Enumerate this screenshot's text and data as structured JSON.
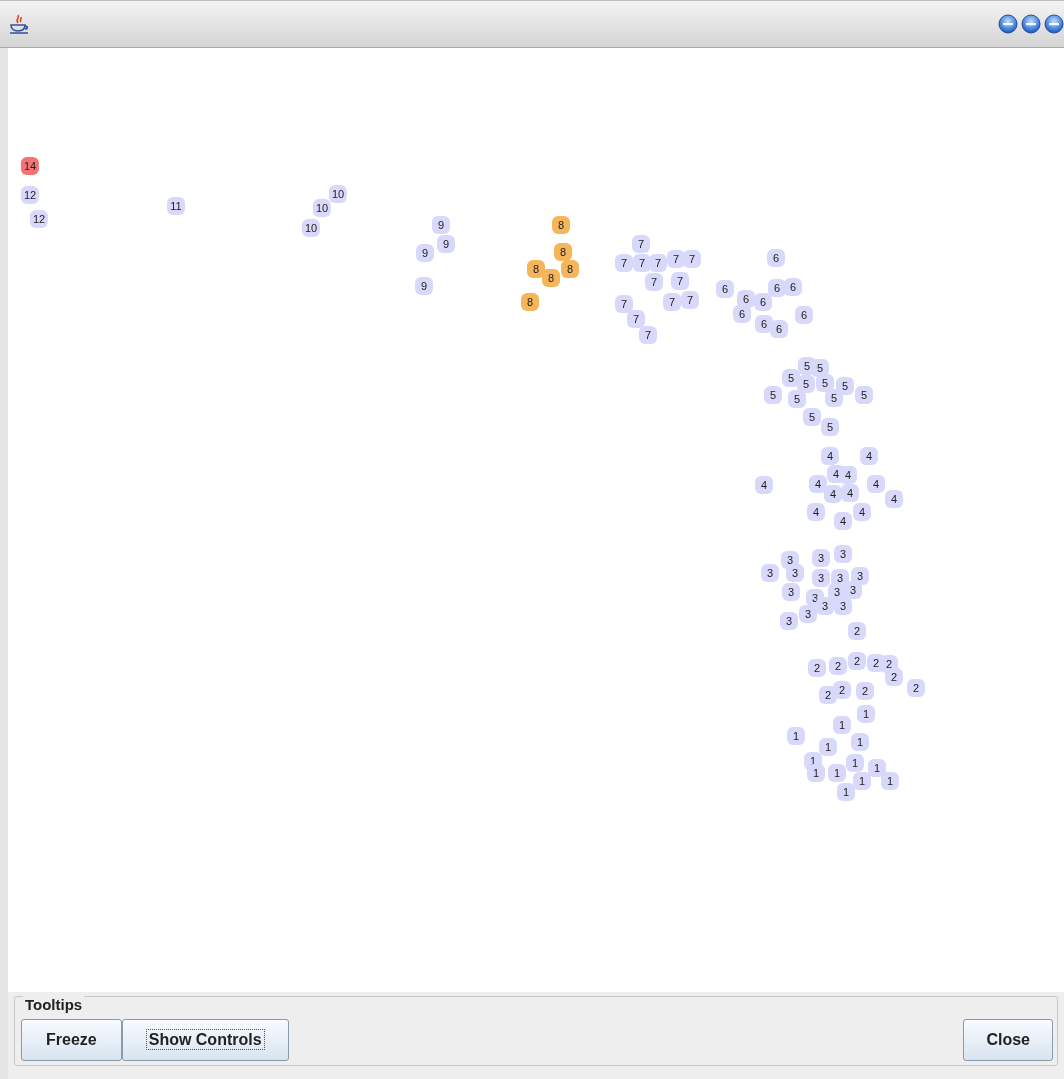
{
  "graph": {
    "nodes": [
      {
        "label": "14",
        "color": "#f47474"
      },
      {
        "label": "12",
        "color": "#d8d8fb"
      },
      {
        "label": "12",
        "color": "#d8d8fb"
      },
      {
        "label": "11",
        "color": "#d8d8fb"
      },
      {
        "label": "10",
        "color": "#d8d8fb"
      },
      {
        "label": "10",
        "color": "#d8d8fb"
      },
      {
        "label": "10",
        "color": "#d8d8fb"
      },
      {
        "label": "9",
        "color": "#d8d8fb"
      },
      {
        "label": "9",
        "color": "#d8d8fb"
      },
      {
        "label": "9",
        "color": "#d8d8fb"
      },
      {
        "label": "9",
        "color": "#d8d8fb"
      },
      {
        "label": "8",
        "color": "#f5b65a"
      },
      {
        "label": "8",
        "color": "#f5b65a"
      },
      {
        "label": "8",
        "color": "#f5b65a"
      },
      {
        "label": "8",
        "color": "#f5b65a"
      },
      {
        "label": "8",
        "color": "#f5b65a"
      },
      {
        "label": "8",
        "color": "#f5b65a"
      },
      {
        "label": "7",
        "color": "#d8d8fb"
      },
      {
        "label": "7",
        "color": "#d8d8fb"
      },
      {
        "label": "7",
        "color": "#d8d8fb"
      },
      {
        "label": "7",
        "color": "#d8d8fb"
      },
      {
        "label": "7",
        "color": "#d8d8fb"
      },
      {
        "label": "7",
        "color": "#d8d8fb"
      },
      {
        "label": "7",
        "color": "#d8d8fb"
      },
      {
        "label": "7",
        "color": "#d8d8fb"
      },
      {
        "label": "7",
        "color": "#d8d8fb"
      },
      {
        "label": "7",
        "color": "#d8d8fb"
      },
      {
        "label": "7",
        "color": "#d8d8fb"
      },
      {
        "label": "7",
        "color": "#d8d8fb"
      },
      {
        "label": "7",
        "color": "#d8d8fb"
      },
      {
        "label": "6",
        "color": "#d8d8fb"
      },
      {
        "label": "6",
        "color": "#d8d8fb"
      },
      {
        "label": "6",
        "color": "#d8d8fb"
      },
      {
        "label": "6",
        "color": "#d8d8fb"
      },
      {
        "label": "6",
        "color": "#d8d8fb"
      },
      {
        "label": "6",
        "color": "#d8d8fb"
      },
      {
        "label": "6",
        "color": "#d8d8fb"
      },
      {
        "label": "6",
        "color": "#d8d8fb"
      },
      {
        "label": "6",
        "color": "#d8d8fb"
      },
      {
        "label": "6",
        "color": "#d8d8fb"
      },
      {
        "label": "5",
        "color": "#d8d8fb"
      },
      {
        "label": "5",
        "color": "#d8d8fb"
      },
      {
        "label": "5",
        "color": "#d8d8fb"
      },
      {
        "label": "5",
        "color": "#d8d8fb"
      },
      {
        "label": "5",
        "color": "#d8d8fb"
      },
      {
        "label": "5",
        "color": "#d8d8fb"
      },
      {
        "label": "5",
        "color": "#d8d8fb"
      },
      {
        "label": "5",
        "color": "#d8d8fb"
      },
      {
        "label": "5",
        "color": "#d8d8fb"
      },
      {
        "label": "5",
        "color": "#d8d8fb"
      },
      {
        "label": "5",
        "color": "#d8d8fb"
      },
      {
        "label": "5",
        "color": "#d8d8fb"
      },
      {
        "label": "4",
        "color": "#d8d8fb"
      },
      {
        "label": "4",
        "color": "#d8d8fb"
      },
      {
        "label": "4",
        "color": "#d8d8fb"
      },
      {
        "label": "4",
        "color": "#d8d8fb"
      },
      {
        "label": "4",
        "color": "#d8d8fb"
      },
      {
        "label": "4",
        "color": "#d8d8fb"
      },
      {
        "label": "4",
        "color": "#d8d8fb"
      },
      {
        "label": "4",
        "color": "#d8d8fb"
      },
      {
        "label": "4",
        "color": "#d8d8fb"
      },
      {
        "label": "4",
        "color": "#d8d8fb"
      },
      {
        "label": "4",
        "color": "#d8d8fb"
      },
      {
        "label": "4",
        "color": "#d8d8fb"
      },
      {
        "label": "4",
        "color": "#d8d8fb"
      },
      {
        "label": "3",
        "color": "#d8d8fb"
      },
      {
        "label": "3",
        "color": "#d8d8fb"
      },
      {
        "label": "3",
        "color": "#d8d8fb"
      },
      {
        "label": "3",
        "color": "#d8d8fb"
      },
      {
        "label": "3",
        "color": "#d8d8fb"
      },
      {
        "label": "3",
        "color": "#d8d8fb"
      },
      {
        "label": "3",
        "color": "#d8d8fb"
      },
      {
        "label": "3",
        "color": "#d8d8fb"
      },
      {
        "label": "3",
        "color": "#d8d8fb"
      },
      {
        "label": "3",
        "color": "#d8d8fb"
      },
      {
        "label": "3",
        "color": "#d8d8fb"
      },
      {
        "label": "3",
        "color": "#d8d8fb"
      },
      {
        "label": "3",
        "color": "#d8d8fb"
      },
      {
        "label": "3",
        "color": "#d8d8fb"
      },
      {
        "label": "3",
        "color": "#d8d8fb"
      },
      {
        "label": "3",
        "color": "#d8d8fb"
      },
      {
        "label": "2",
        "color": "#d8d8fb"
      },
      {
        "label": "2",
        "color": "#d8d8fb"
      },
      {
        "label": "2",
        "color": "#d8d8fb"
      },
      {
        "label": "2",
        "color": "#d8d8fb"
      },
      {
        "label": "2",
        "color": "#d8d8fb"
      },
      {
        "label": "2",
        "color": "#d8d8fb"
      },
      {
        "label": "2",
        "color": "#d8d8fb"
      },
      {
        "label": "2",
        "color": "#d8d8fb"
      },
      {
        "label": "2",
        "color": "#d8d8fb"
      },
      {
        "label": "2",
        "color": "#d8d8fb"
      },
      {
        "label": "2",
        "color": "#d8d8fb"
      },
      {
        "label": "1",
        "color": "#d8d8fb"
      },
      {
        "label": "1",
        "color": "#d8d8fb"
      },
      {
        "label": "1",
        "color": "#d8d8fb"
      },
      {
        "label": "1",
        "color": "#d8d8fb"
      },
      {
        "label": "1",
        "color": "#d8d8fb"
      },
      {
        "label": "1",
        "color": "#d8d8fb"
      },
      {
        "label": "1",
        "color": "#d8d8fb"
      },
      {
        "label": "1",
        "color": "#d8d8fb"
      },
      {
        "label": "1",
        "color": "#d8d8fb"
      },
      {
        "label": "1",
        "color": "#d8d8fb"
      },
      {
        "label": "1",
        "color": "#d8d8fb"
      },
      {
        "label": "1",
        "color": "#d8d8fb"
      },
      {
        "label": "1",
        "color": "#d8d8fb"
      }
    ]
  },
  "tooltips": {
    "title": "Tooltips",
    "buttons": [
      {
        "label": "Freeze",
        "focused": false
      },
      {
        "label": "Show Controls",
        "focused": true
      }
    ]
  },
  "close_button": {
    "label": "Close"
  }
}
